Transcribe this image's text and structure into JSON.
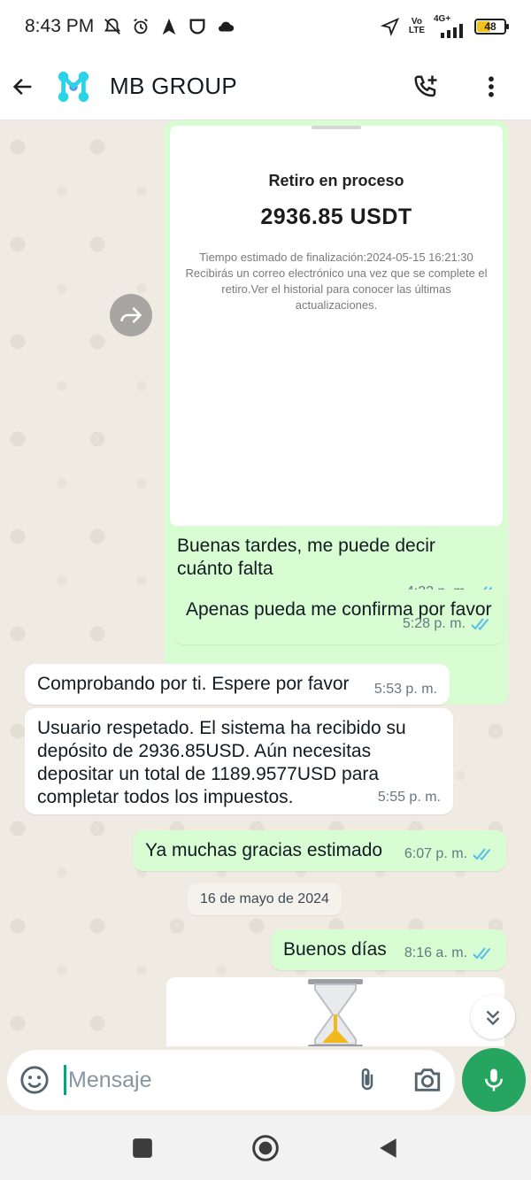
{
  "status_bar": {
    "time": "8:43 PM",
    "network_vo": "Vo",
    "network_lte": "LTE",
    "network_4g": "4G+",
    "battery": "48"
  },
  "header": {
    "title": "MB GROUP",
    "logo_icon": "mb-logo",
    "accent": "#2ad4e8"
  },
  "image_card": {
    "title": "Retiro en proceso",
    "amount": "2936.85 USDT",
    "detail_line1": "Tiempo estimado de finalización:2024-05-15 16:21:30",
    "detail_line2": "Recibirás un correo electrónico una vez que se complete el retiro.Ver el historial para conocer las últimas actualizaciones.",
    "caption": "Buenas tardes, me puede decir cuánto falta",
    "time": "4:22 p. m."
  },
  "messages": [
    {
      "direction": "out",
      "text": "Apenas pueda me confirma por favor",
      "time": "5:28 p. m."
    },
    {
      "direction": "in",
      "text": "Comprobando por ti. Espere por favor",
      "time": "5:53 p. m."
    },
    {
      "direction": "in",
      "text": "Usuario respetado. El sistema ha recibido su depósito de 2936.85USD. Aún necesitas depositar un total de 1189.9577USD para completar todos los impuestos.",
      "time": "5:55 p. m."
    },
    {
      "direction": "out",
      "text": "Ya muchas gracias estimado",
      "time": "6:07 p. m."
    },
    {
      "direction": "out",
      "text": "Buenos días",
      "time": "8:16 a. m."
    }
  ],
  "date_chip": "16 de mayo de 2024",
  "input": {
    "placeholder": "Mensaje"
  },
  "colors": {
    "outgoing_bubble": "#d9fdd3",
    "incoming_bubble": "#ffffff",
    "read_ticks": "#53bdeb",
    "mic_button": "#25a55f",
    "chat_bg": "#efeae2"
  }
}
